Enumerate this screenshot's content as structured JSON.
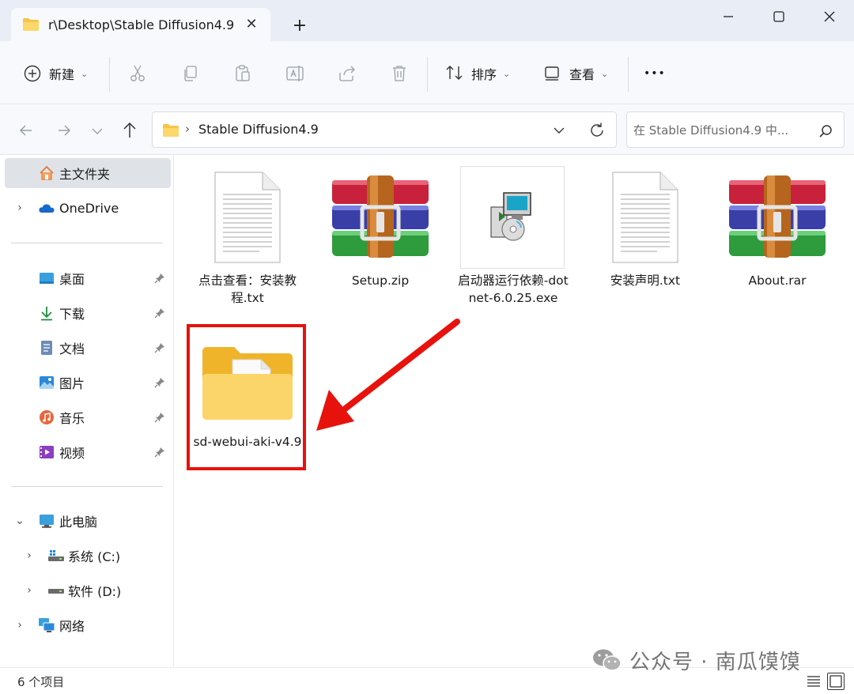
{
  "window": {
    "tab_title": "r\\Desktop\\Stable Diffusion4.9",
    "tab_close": "✕",
    "new_tab": "+"
  },
  "toolbar": {
    "new_label": "新建",
    "sort_label": "排序",
    "view_label": "查看",
    "more_label": "•••"
  },
  "address": {
    "path": "Stable Diffusion4.9",
    "separator": "›"
  },
  "search": {
    "placeholder": "在 Stable Diffusion4.9 中..."
  },
  "sidebar": {
    "home": "主文件夹",
    "onedrive": "OneDrive",
    "quick_access": [
      {
        "label": "桌面",
        "icon": "desktop-icon"
      },
      {
        "label": "下载",
        "icon": "download-icon"
      },
      {
        "label": "文档",
        "icon": "documents-icon"
      },
      {
        "label": "图片",
        "icon": "pictures-icon"
      },
      {
        "label": "音乐",
        "icon": "music-icon"
      },
      {
        "label": "视频",
        "icon": "videos-icon"
      }
    ],
    "this_pc": "此电脑",
    "drives": [
      {
        "label": "系统 (C:)"
      },
      {
        "label": "软件 (D:)"
      }
    ],
    "network": "网络"
  },
  "files": [
    {
      "name": "点击查看：安装教程.txt",
      "icon": "text-file-icon"
    },
    {
      "name": "Setup.zip",
      "icon": "winrar-archive-icon"
    },
    {
      "name": "启动器运行依赖-dotnet-6.0.25.exe",
      "icon": "installer-exe-icon"
    },
    {
      "name": "安装声明.txt",
      "icon": "text-file-icon"
    },
    {
      "name": "About.rar",
      "icon": "winrar-archive-icon"
    },
    {
      "name": "sd-webui-aki-v4.9",
      "icon": "folder-icon"
    }
  ],
  "status": {
    "item_count": "6 个项目"
  },
  "watermark": {
    "text": "公众号 · 南瓜馍馍"
  },
  "colors": {
    "highlight": "#e8120c",
    "folder": "#f5c44a",
    "accent": "#0067c0"
  }
}
